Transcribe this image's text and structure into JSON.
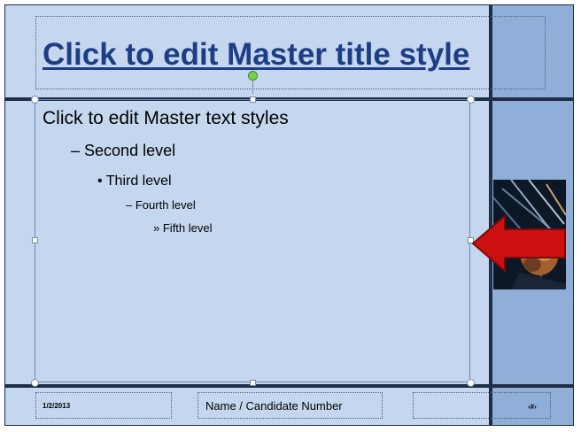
{
  "slide": {
    "title": "Click to edit Master title style",
    "body_levels": [
      "Click to edit Master text styles",
      "Second level",
      "Third level",
      "Fourth level",
      "Fifth level"
    ],
    "bullets": [
      "",
      "–",
      "•",
      "–",
      "»"
    ],
    "footer": {
      "date": "1/2/2013",
      "name": "Name / Candidate Number",
      "slide_number": "‹#›"
    }
  },
  "colors": {
    "background": "#c5d7ef",
    "accent_band": "#8fafd8",
    "lines": "#1f2d47",
    "title_text": "#1d3d85",
    "arrow_fill": "#cc1010",
    "selection_handle": "#78d24f"
  },
  "icons": {
    "arrow": "left-arrow-icon",
    "image": "lionfish-image"
  }
}
